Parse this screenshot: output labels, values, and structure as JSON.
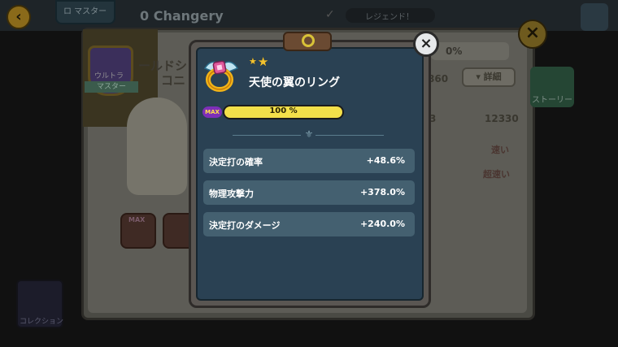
{
  "background": {
    "top_badge_text": "ロ マスター",
    "cookie_name_top": "0 Changery",
    "star_chip_text": "レジェンド！",
    "rank_label": "ウルトラ",
    "rank_sub_label": "マスター",
    "cookie_title_line1": "ールドシ",
    "cookie_title_line2": "コニ",
    "item_max": "MAX",
    "collection_label": "コレクション",
    "percent": "0%",
    "stat_value_1": "860",
    "stat_value_2": "12330",
    "stat_value_3": "3",
    "detail_button": "▾ 詳細",
    "story_label": "ストーリー",
    "speed_1": "速い",
    "speed_2": "超速い"
  },
  "modal": {
    "treasure_name": "天使の翼のリング",
    "stars_count": 2,
    "max_label": "MAX",
    "progress_text": "100 %",
    "progress_value": 1.0,
    "divider_ornament": "⚜",
    "close_icon": "×",
    "stats": [
      {
        "label": "決定打の確率",
        "value": "+48.6%"
      },
      {
        "label": "物理攻撃力",
        "value": "+378.0%"
      },
      {
        "label": "決定打のダメージ",
        "value": "+240.0%"
      }
    ]
  },
  "colors": {
    "modal_bg": "#2a4153",
    "stat_row_bg": "#446070",
    "progress_fill": "#f3e04a",
    "max_badge": "#7d2fb8",
    "star": "#f2c230"
  }
}
